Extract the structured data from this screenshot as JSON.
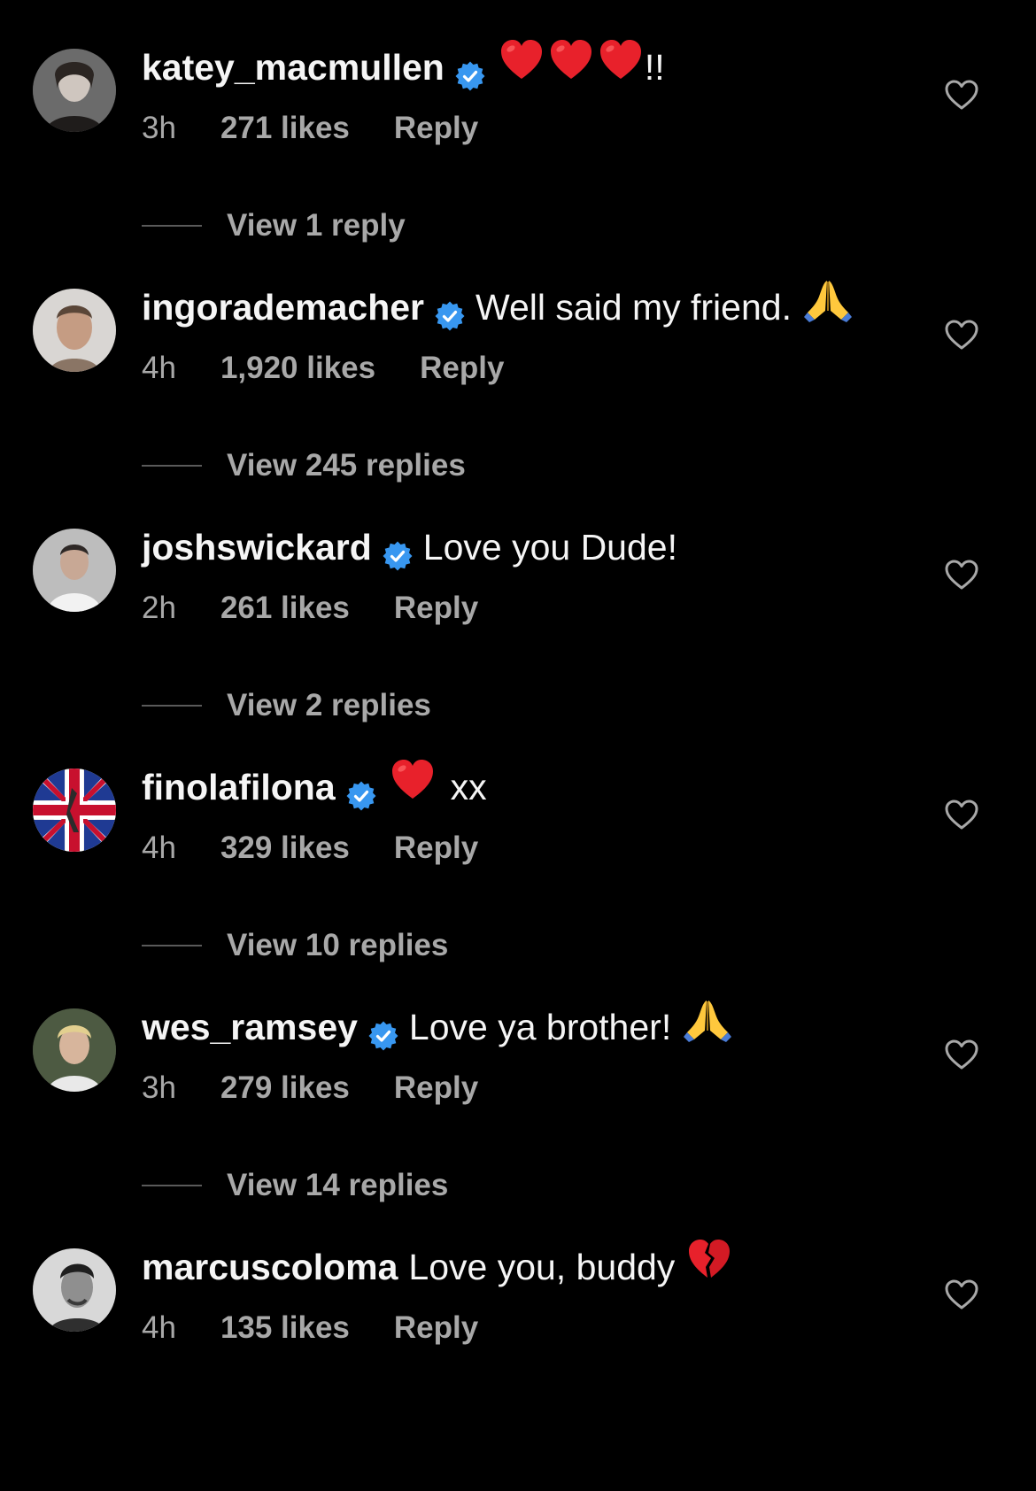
{
  "colors": {
    "background": "#000000",
    "primary_text": "#f5f5f5",
    "secondary_text": "#a8a8a8",
    "verified_badge": "#3897f0"
  },
  "comments": [
    {
      "username": "katey_macmullen",
      "verified": true,
      "text_before": "",
      "emojis": [
        "red-heart",
        "red-heart",
        "red-heart"
      ],
      "text_after": "!!",
      "time": "3h",
      "likes": "271 likes",
      "reply": "Reply",
      "view_replies": "View 1 reply"
    },
    {
      "username": "ingorademacher",
      "verified": true,
      "text_before": "Well said my friend.",
      "emojis": [
        "folded-hands"
      ],
      "text_after": "",
      "time": "4h",
      "likes": "1,920 likes",
      "reply": "Reply",
      "view_replies": "View 245 replies"
    },
    {
      "username": "joshswickard",
      "verified": true,
      "text_before": "Love you Dude!",
      "emojis": [],
      "text_after": "",
      "time": "2h",
      "likes": "261 likes",
      "reply": "Reply",
      "view_replies": "View 2 replies"
    },
    {
      "username": "finolafilona",
      "verified": true,
      "text_before": "",
      "emojis": [
        "red-heart"
      ],
      "text_after": "xx",
      "time": "4h",
      "likes": "329 likes",
      "reply": "Reply",
      "view_replies": "View 10 replies"
    },
    {
      "username": "wes_ramsey",
      "verified": true,
      "text_before": "Love ya brother!",
      "emojis": [
        "folded-hands"
      ],
      "text_after": "",
      "time": "3h",
      "likes": "279 likes",
      "reply": "Reply",
      "view_replies": "View 14 replies"
    },
    {
      "username": "marcuscoloma",
      "verified": false,
      "text_before": "Love you, buddy",
      "emojis": [
        "broken-heart"
      ],
      "text_after": "",
      "time": "4h",
      "likes": "135 likes",
      "reply": "Reply",
      "view_replies": ""
    }
  ]
}
